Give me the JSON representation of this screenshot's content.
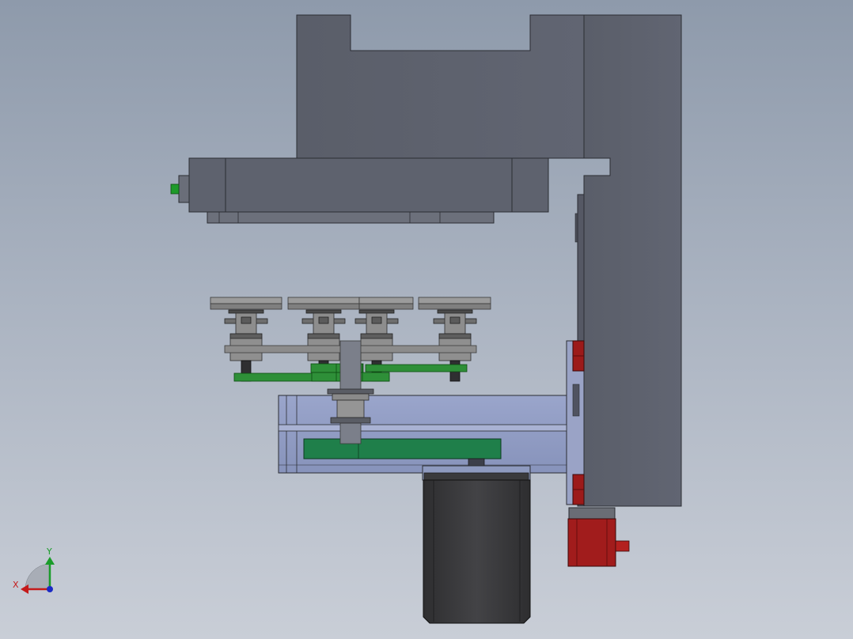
{
  "view": {
    "background_top": "#8e9aab",
    "background_bottom": "#c9ced7"
  },
  "colors": {
    "frame_gray": "#5d616d",
    "frame_edge": "#2b2d33",
    "slide_blue": "#8f9bc2",
    "belt_green": "#2f8a3a",
    "motor_black": "#3b3b3d",
    "servo_red": "#9c1a1a",
    "pulley_gray": "#8a8a8a"
  },
  "triad": {
    "x_label": "X",
    "y_label": "Y",
    "x_color": "#c41a1a",
    "y_color": "#1a9c2a",
    "z_color": "#1a2ac4"
  },
  "components": [
    "upper-frame-block",
    "vertical-column",
    "horizontal-spindle-housing",
    "pulley-array",
    "belt-drive",
    "linear-slide-assembly",
    "stepper-motor",
    "servo-motor",
    "guide-rail"
  ]
}
